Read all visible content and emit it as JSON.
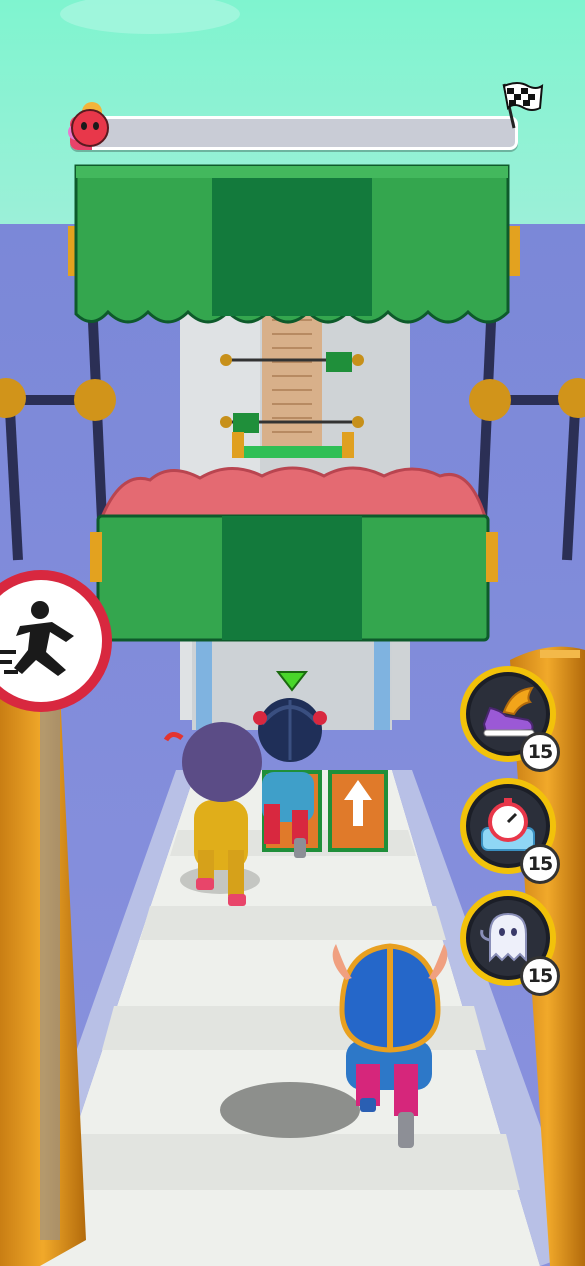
{
  "game": {
    "progress": {
      "fraction": 0.05,
      "player_icon": "red-blob-avatar",
      "goal_icon": "checkered-flag-icon"
    },
    "powerups": [
      {
        "name": "winged-shoe-icon",
        "count": "15"
      },
      {
        "name": "stopwatch-freeze-icon",
        "count": "15"
      },
      {
        "name": "ghost-icon",
        "count": "15"
      }
    ],
    "sign": {
      "icon": "jumping-runner-icon"
    },
    "track": {
      "arrow_icon": "up-arrow-icon"
    },
    "indicator": {
      "icon": "green-triangle-marker"
    }
  },
  "colors": {
    "sky": "#7ff2cc",
    "water": "#7e8ad6",
    "track": "#eef0ec",
    "awning_green": "#2f9f4a",
    "awning_dark": "#137a3c",
    "roof_pink": "#e46a72",
    "progress_fill": "#e8436a",
    "powerup_ring": "#f2c20a"
  }
}
